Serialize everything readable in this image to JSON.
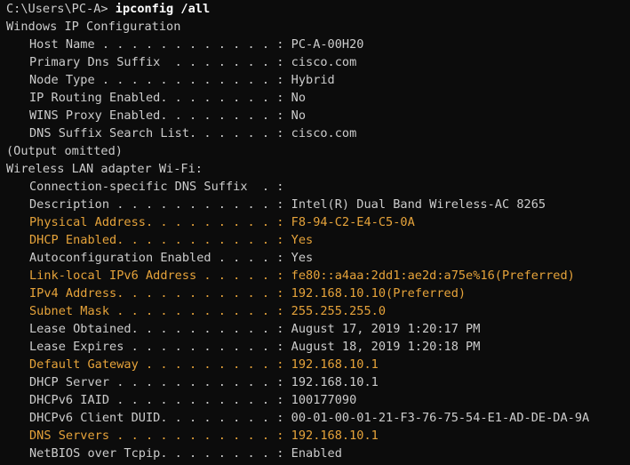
{
  "prompt": {
    "path": "C:\\Users\\PC-A> ",
    "command": "ipconfig /all"
  },
  "header": "Windows IP Configuration",
  "global_entries": [
    {
      "label": "Host Name . . . . . . . . . . . . : ",
      "value": "PC-A-00H20",
      "highlight": false
    },
    {
      "label": "Primary Dns Suffix  . . . . . . . : ",
      "value": "cisco.com",
      "highlight": false
    },
    {
      "label": "Node Type . . . . . . . . . . . . : ",
      "value": "Hybrid",
      "highlight": false
    },
    {
      "label": "IP Routing Enabled. . . . . . . . : ",
      "value": "No",
      "highlight": false
    },
    {
      "label": "WINS Proxy Enabled. . . . . . . . : ",
      "value": "No",
      "highlight": false
    },
    {
      "label": "DNS Suffix Search List. . . . . . : ",
      "value": "cisco.com",
      "highlight": false
    }
  ],
  "omitted_note": "(Output omitted)",
  "adapter_header": "Wireless LAN adapter Wi-Fi:",
  "adapter_entries": [
    {
      "label": "Connection-specific DNS Suffix  . : ",
      "value": "",
      "highlight": false
    },
    {
      "label": "Description . . . . . . . . . . . : ",
      "value": "Intel(R) Dual Band Wireless-AC 8265",
      "highlight": false
    },
    {
      "label": "Physical Address. . . . . . . . . : ",
      "value": "F8-94-C2-E4-C5-0A",
      "highlight": true
    },
    {
      "label": "DHCP Enabled. . . . . . . . . . . : ",
      "value": "Yes",
      "highlight": true
    },
    {
      "label": "Autoconfiguration Enabled . . . . : ",
      "value": "Yes",
      "highlight": false
    },
    {
      "label": "Link-local IPv6 Address . . . . . : ",
      "value": "fe80::a4aa:2dd1:ae2d:a75e%16(Preferred)",
      "highlight": true
    },
    {
      "label": "IPv4 Address. . . . . . . . . . . : ",
      "value": "192.168.10.10(Preferred)",
      "highlight": true
    },
    {
      "label": "Subnet Mask . . . . . . . . . . . : ",
      "value": "255.255.255.0",
      "highlight": true
    },
    {
      "label": "Lease Obtained. . . . . . . . . . : ",
      "value": "August 17, 2019 1:20:17 PM",
      "highlight": false
    },
    {
      "label": "Lease Expires . . . . . . . . . . : ",
      "value": "August 18, 2019 1:20:18 PM",
      "highlight": false
    },
    {
      "label": "Default Gateway . . . . . . . . . : ",
      "value": "192.168.10.1",
      "highlight": true
    },
    {
      "label": "DHCP Server . . . . . . . . . . . : ",
      "value": "192.168.10.1",
      "highlight": false
    },
    {
      "label": "DHCPv6 IAID . . . . . . . . . . . : ",
      "value": "100177090",
      "highlight": false
    },
    {
      "label": "DHCPv6 Client DUID. . . . . . . . : ",
      "value": "00-01-00-01-21-F3-76-75-54-E1-AD-DE-DA-9A",
      "highlight": false
    },
    {
      "label": "DNS Servers . . . . . . . . . . . : ",
      "value": "192.168.10.1",
      "highlight": true
    },
    {
      "label": "NetBIOS over Tcpip. . . . . . . . : ",
      "value": "Enabled",
      "highlight": false
    }
  ],
  "colors": {
    "background": "#0c0c0c",
    "text": "#cccccc",
    "command": "#ffffff",
    "highlight": "#e6a33a"
  }
}
